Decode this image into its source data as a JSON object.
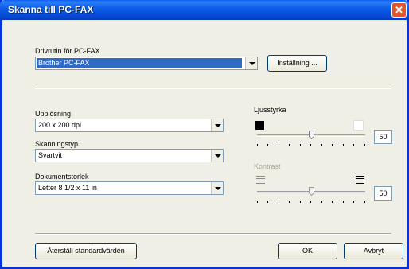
{
  "window": {
    "title": "Skanna till PC-FAX",
    "close_glyph": "✕"
  },
  "driver": {
    "label": "Drivrutin för PC-FAX",
    "selected": "Brother PC-FAX",
    "settings_button": "Inställning ..."
  },
  "resolution": {
    "label": "Upplösning",
    "selected": "200 x 200 dpi"
  },
  "scan_type": {
    "label": "Skanningstyp",
    "selected": "Svartvit"
  },
  "document_size": {
    "label": "Dokumentstorlek",
    "selected": "Letter 8 1/2 x 11 in"
  },
  "brightness": {
    "label": "Ljusstyrka",
    "value": "50",
    "level": 0.5
  },
  "contrast": {
    "label": "Kontrast",
    "value": "50",
    "level": 0.5,
    "enabled": false
  },
  "footer": {
    "restore_button": "Återställ standardvärden",
    "ok_button": "OK",
    "cancel_button": "Avbryt"
  }
}
